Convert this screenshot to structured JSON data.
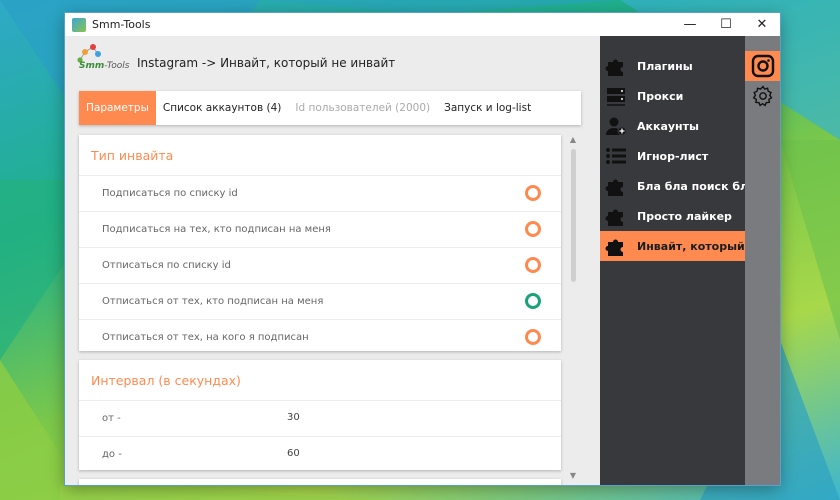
{
  "window": {
    "title": "Smm-Tools"
  },
  "window_controls": {
    "minimize": "—",
    "maximize": "☐",
    "close": "✕"
  },
  "logo": {
    "brand": "Smm",
    "suffix": "-Tools"
  },
  "breadcrumb": "Instagram -> Инвайт, который не инвайт",
  "tabs": [
    {
      "label": "Параметры",
      "state": "active"
    },
    {
      "label": "Список аккаунтов (4)",
      "state": "normal"
    },
    {
      "label": "Id пользователей (2000)",
      "state": "disabled"
    },
    {
      "label": "Запуск и log-list",
      "state": "normal"
    }
  ],
  "invite_type": {
    "title": "Тип инвайта",
    "options": [
      {
        "label": "Подписаться по списку id",
        "selected": false
      },
      {
        "label": "Подписаться на тех, кто подписан на меня",
        "selected": false
      },
      {
        "label": "Отписаться по списку id",
        "selected": false
      },
      {
        "label": "Отписаться от тех, кто подписан на меня",
        "selected": true
      },
      {
        "label": "Отписаться от тех, на кого я подписан",
        "selected": false
      }
    ]
  },
  "interval": {
    "title": "Интервал (в секундах)",
    "from": {
      "label": "от -",
      "value": "30"
    },
    "to": {
      "label": "до -",
      "value": "60"
    }
  },
  "sidebar": {
    "items": [
      {
        "label": "Плагины",
        "icon": "puzzle-icon"
      },
      {
        "label": "Прокси",
        "icon": "server-icon"
      },
      {
        "label": "Аккаунты",
        "icon": "user-add-icon"
      },
      {
        "label": "Игнор-лист",
        "icon": "list-icon"
      },
      {
        "label": "Бла бла поиск бла",
        "icon": "puzzle-icon"
      },
      {
        "label": "Просто лайкер",
        "icon": "puzzle-icon"
      },
      {
        "label": "Инвайт, который не инвайт",
        "icon": "puzzle-icon",
        "active": true
      }
    ]
  },
  "rail": [
    {
      "icon": "instagram-icon",
      "active": true
    },
    {
      "icon": "gear-icon",
      "active": false
    }
  ],
  "colors": {
    "accent": "#ff8a50",
    "selected_radio": "#1aa37a",
    "sidebar_bg": "#38393c",
    "rail_bg": "#7a7b7e"
  }
}
